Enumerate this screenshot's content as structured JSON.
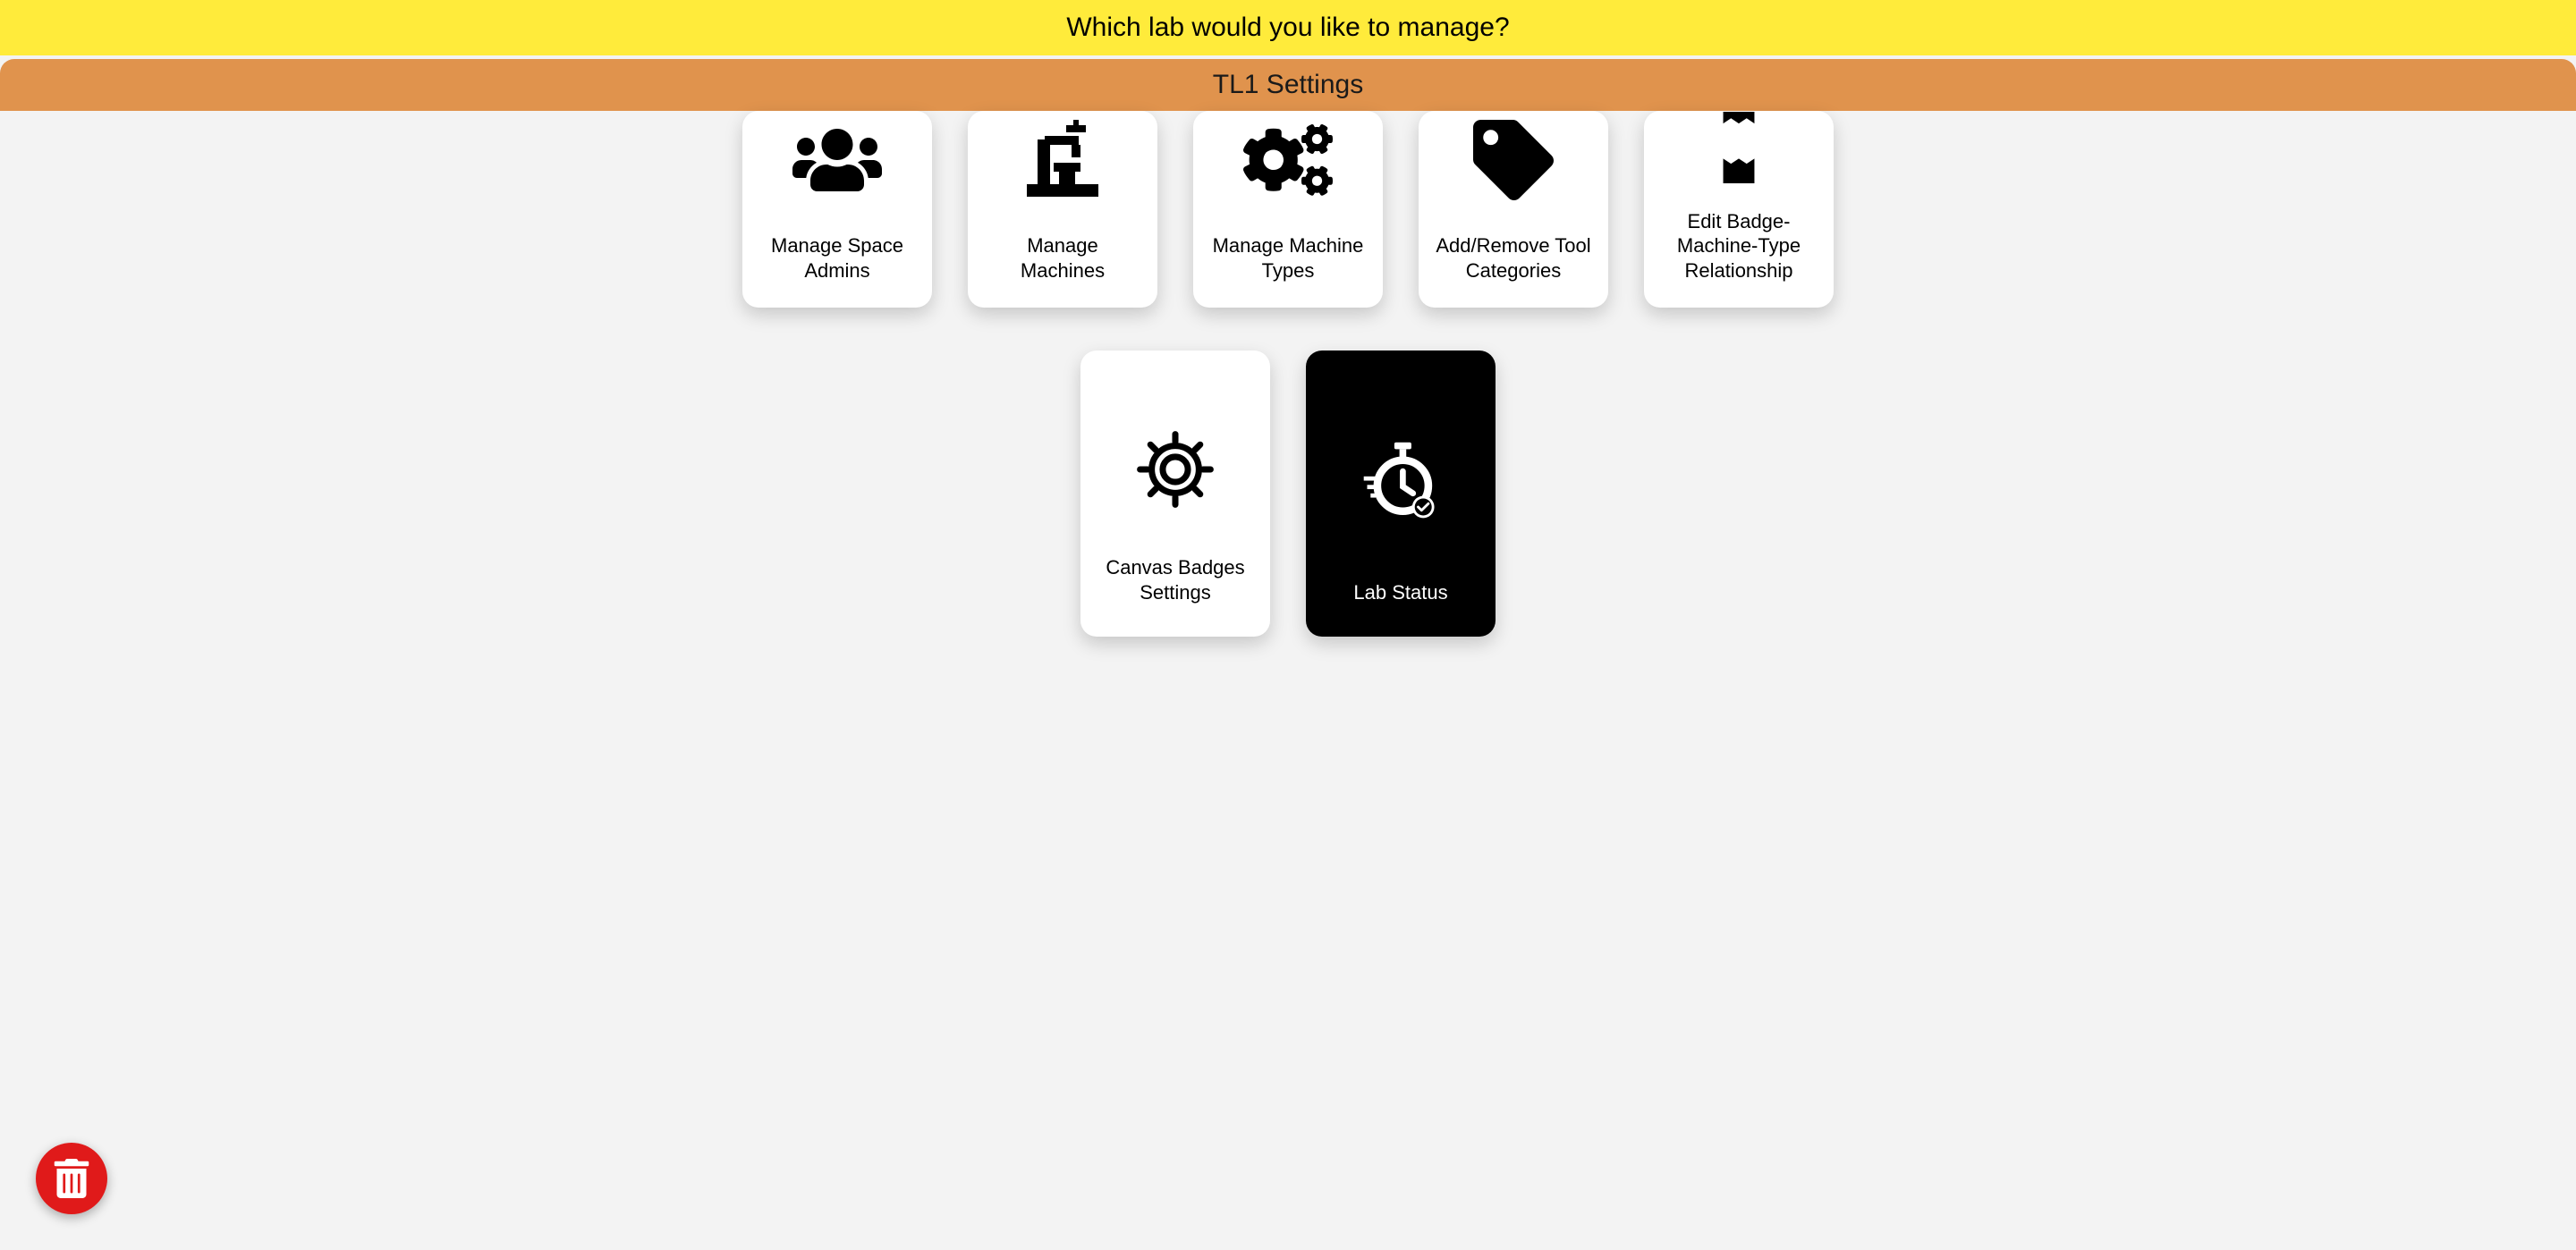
{
  "header": {
    "page_title": "Which lab would you like to manage?",
    "settings_title": "TL1 Settings"
  },
  "cards": {
    "manage_space_admins": "Manage Space Admins",
    "manage_machines": "Manage Machines",
    "manage_machine_types": "Manage Machine Types",
    "add_remove_tool_categories": "Add/Remove Tool Categories",
    "edit_badge_machine_type": "Edit Badge-Machine-Type Relationship",
    "canvas_badges_settings": "Canvas Badges Settings",
    "lab_status": "Lab Status"
  }
}
